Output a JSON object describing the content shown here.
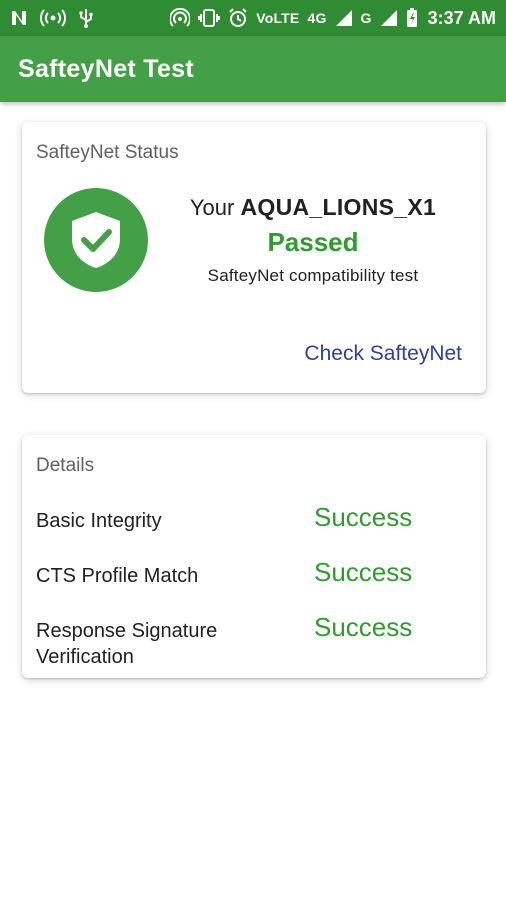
{
  "status_bar": {
    "volte": "VoLTE",
    "net_4g": "4G",
    "net_g": "G",
    "time": "3:37 AM",
    "icons": [
      "notification-n-icon",
      "wifi-hotspot-icon",
      "usb-icon",
      "hotspot-icon",
      "vibrate-icon",
      "alarm-icon",
      "signal-icon",
      "battery-icon"
    ]
  },
  "app_bar": {
    "title": "SafteyNet Test"
  },
  "status_card": {
    "title": "SafteyNet Status",
    "your_prefix": "Your",
    "device_name": "AQUA_LIONS_X1",
    "result": "Passed",
    "description": "SafteyNet compatibility test",
    "check_button": "Check SafteyNet",
    "icon": "shield-check-icon"
  },
  "details_card": {
    "title": "Details",
    "rows": [
      {
        "label": "Basic Integrity",
        "value": "Success"
      },
      {
        "label": "CTS Profile Match",
        "value": "Success"
      },
      {
        "label": "Response Signature Verification",
        "value": "Success"
      }
    ]
  },
  "colors": {
    "status_bar": "#2f8c33",
    "app_bar": "#43a047",
    "success_green": "#2e9c2e",
    "link_blue": "#303f9f"
  }
}
